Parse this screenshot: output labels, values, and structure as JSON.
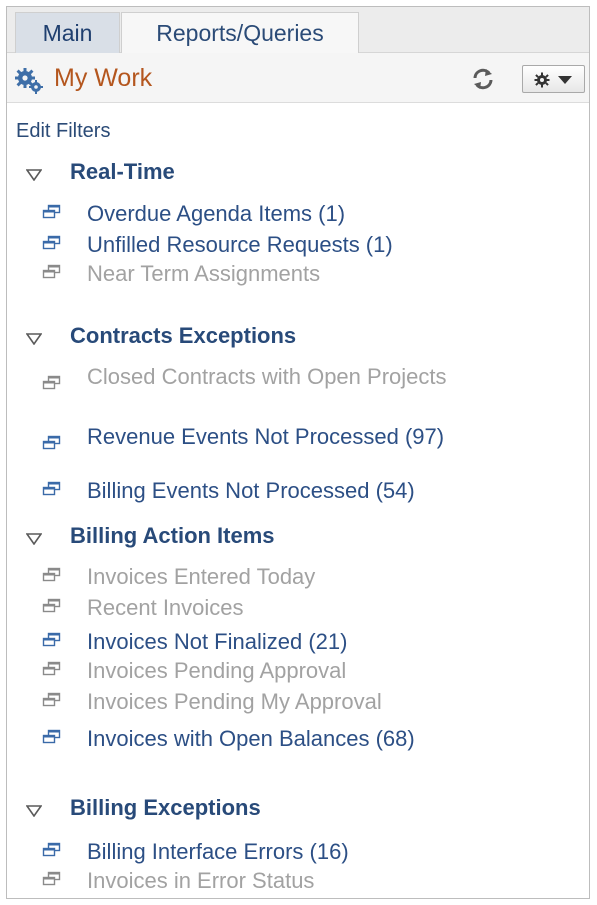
{
  "tabs": {
    "main": "Main",
    "reports": "Reports/Queries"
  },
  "pagelet": {
    "title": "My Work"
  },
  "icons": {
    "app": "gear-logo-icon",
    "refresh": "refresh-icon",
    "actions": "gear-icon",
    "actions_caret": "caret-down-icon",
    "section_toggle": "triangle-down-icon",
    "item": "window-link-icon"
  },
  "colors": {
    "title": "#b4561e",
    "link": "#2c4f85",
    "disabled": "#a2a2a2",
    "section": "#284a79"
  },
  "edit_filters": "Edit Filters",
  "sections": [
    {
      "title": "Real-Time",
      "items": [
        {
          "label": "Overdue Agenda Items (1)",
          "active": true
        },
        {
          "label": "Unfilled Resource Requests (1)",
          "active": true
        },
        {
          "label": "Near Term Assignments",
          "active": false
        }
      ]
    },
    {
      "title": "Contracts Exceptions",
      "items": [
        {
          "label": "Closed Contracts with Open Projects",
          "active": false
        },
        {
          "label": "Revenue Events Not Processed (97)",
          "active": true
        },
        {
          "label": "Billing Events Not Processed (54)",
          "active": true
        }
      ]
    },
    {
      "title": "Billing Action Items",
      "items": [
        {
          "label": "Invoices Entered Today",
          "active": false
        },
        {
          "label": "Recent Invoices",
          "active": false
        },
        {
          "label": "Invoices Not Finalized (21)",
          "active": true
        },
        {
          "label": "Invoices Pending Approval",
          "active": false
        },
        {
          "label": "Invoices Pending My Approval",
          "active": false
        },
        {
          "label": "Invoices with Open Balances (68)",
          "active": true
        }
      ]
    },
    {
      "title": "Billing Exceptions",
      "items": [
        {
          "label": "Billing Interface Errors (16)",
          "active": true
        },
        {
          "label": "Invoices in Error Status",
          "active": false
        }
      ]
    }
  ]
}
